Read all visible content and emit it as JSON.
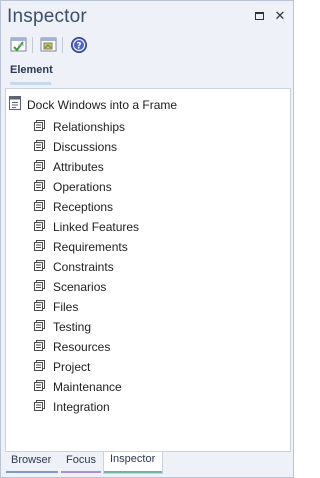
{
  "window": {
    "title": "Inspector",
    "maximize_icon": "maximize-icon",
    "close_icon": "close-icon",
    "close_glyph": "✕"
  },
  "toolbar": {
    "buttons": [
      {
        "icon": "check-properties-icon"
      },
      {
        "icon": "image-properties-icon"
      },
      {
        "icon": "help-icon",
        "glyph": "?"
      }
    ]
  },
  "tabs": [
    {
      "label": "Element",
      "active": true
    }
  ],
  "tree": {
    "root_label": "Dock Windows into a Frame",
    "root_icon": "document-icon",
    "item_icon": "node-icon",
    "items": [
      "Relationships",
      "Discussions",
      "Attributes",
      "Operations",
      "Receptions",
      "Linked Features",
      "Requirements",
      "Constraints",
      "Scenarios",
      "Files",
      "Testing",
      "Resources",
      "Project",
      "Maintenance",
      "Integration"
    ]
  },
  "bottom_tabs": [
    {
      "label": "Browser",
      "color": "#7f9bc4"
    },
    {
      "label": "Focus",
      "color": "#a88fd6"
    },
    {
      "label": "Inspector",
      "color": "#6fb3a7",
      "active": true
    }
  ],
  "colors": {
    "frame_bg": "#eef2f8",
    "title_text": "#3c4e6b",
    "panel_border": "#c9d2de"
  }
}
